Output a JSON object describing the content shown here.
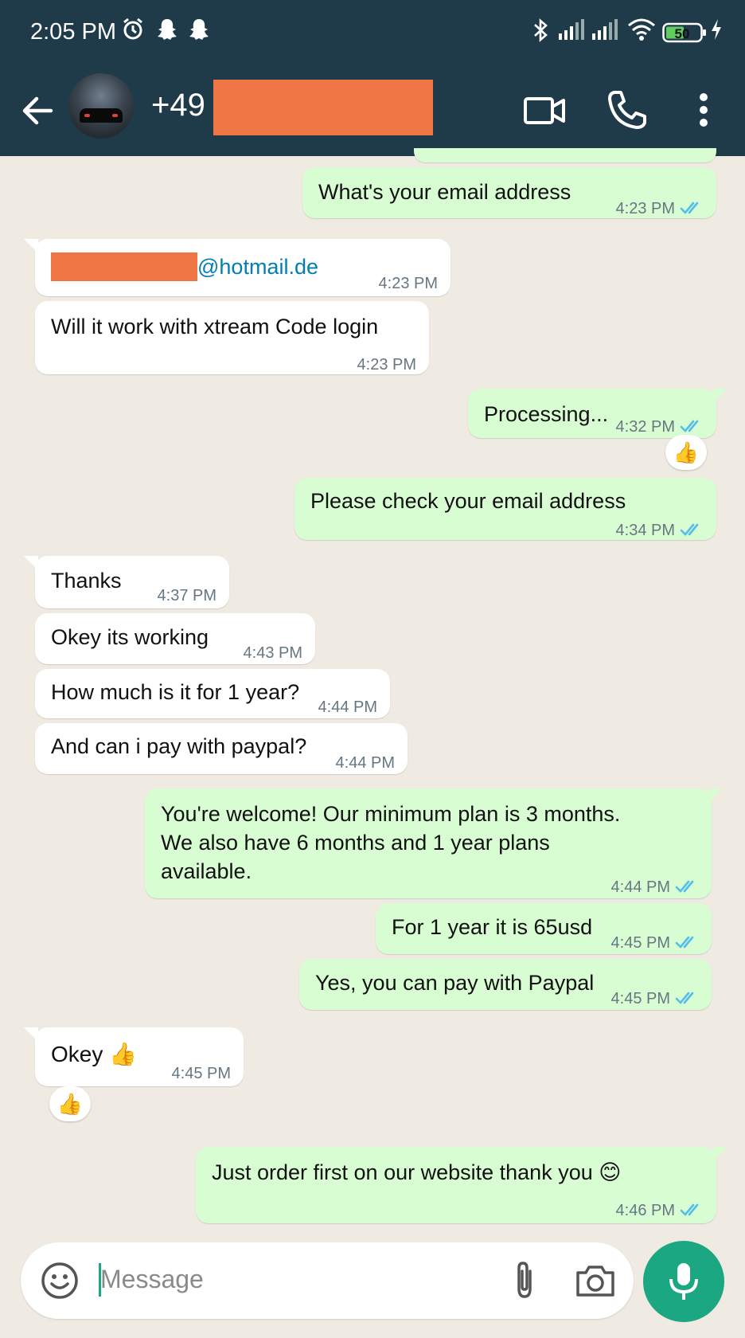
{
  "status_bar": {
    "time": "2:05 PM",
    "icons": [
      "alarm-icon",
      "snapchat-icon",
      "snapchat-icon",
      "bluetooth-icon",
      "signal-icon",
      "signal-icon",
      "wifi-icon",
      "battery-icon",
      "charging-icon"
    ],
    "battery_level": "50"
  },
  "header": {
    "contact_prefix": "+49",
    "actions": [
      "video-call-icon",
      "voice-call-icon",
      "more-vert-icon"
    ]
  },
  "messages": [
    {
      "dir": "out",
      "text": "What's your email address",
      "time": "4:23 PM"
    },
    {
      "dir": "in",
      "text": "@hotmail.de",
      "time": "4:23 PM"
    },
    {
      "dir": "in",
      "text": "Will it work with xtream Code login",
      "time": "4:23 PM"
    },
    {
      "dir": "out",
      "text": "Processing...",
      "time": "4:32 PM",
      "reaction": "👍"
    },
    {
      "dir": "out",
      "text": "Please check your email address",
      "time": "4:34 PM"
    },
    {
      "dir": "in",
      "text": "Thanks",
      "time": "4:37 PM"
    },
    {
      "dir": "in",
      "text": "Okey its working",
      "time": "4:43 PM"
    },
    {
      "dir": "in",
      "text": "How much is it for 1 year?",
      "time": "4:44 PM"
    },
    {
      "dir": "in",
      "text": "And can i pay with paypal?",
      "time": "4:44 PM"
    },
    {
      "dir": "out",
      "text": "You're welcome! Our minimum plan is 3 months.\nWe also have 6 months and 1 year plans\navailable.",
      "time": "4:44 PM"
    },
    {
      "dir": "out",
      "text": "For 1 year it is 65usd",
      "time": "4:45 PM"
    },
    {
      "dir": "out",
      "text": "Yes, you can pay with Paypal",
      "time": "4:45 PM"
    },
    {
      "dir": "in",
      "text": "Okey 👍",
      "time": "4:45 PM",
      "reaction": "👍"
    },
    {
      "dir": "out",
      "text": "Just order first on our website thank you 😊",
      "time": "4:46 PM"
    }
  ],
  "composer": {
    "placeholder": "Message"
  },
  "colors": {
    "header_bg": "#1f3b4a",
    "chat_bg": "#efeae2",
    "outgoing_bubble": "#d9fdd3",
    "incoming_bubble": "#ffffff",
    "read_tick": "#53bdeb",
    "accent": "#1aa782",
    "redaction": "#ef7644"
  }
}
